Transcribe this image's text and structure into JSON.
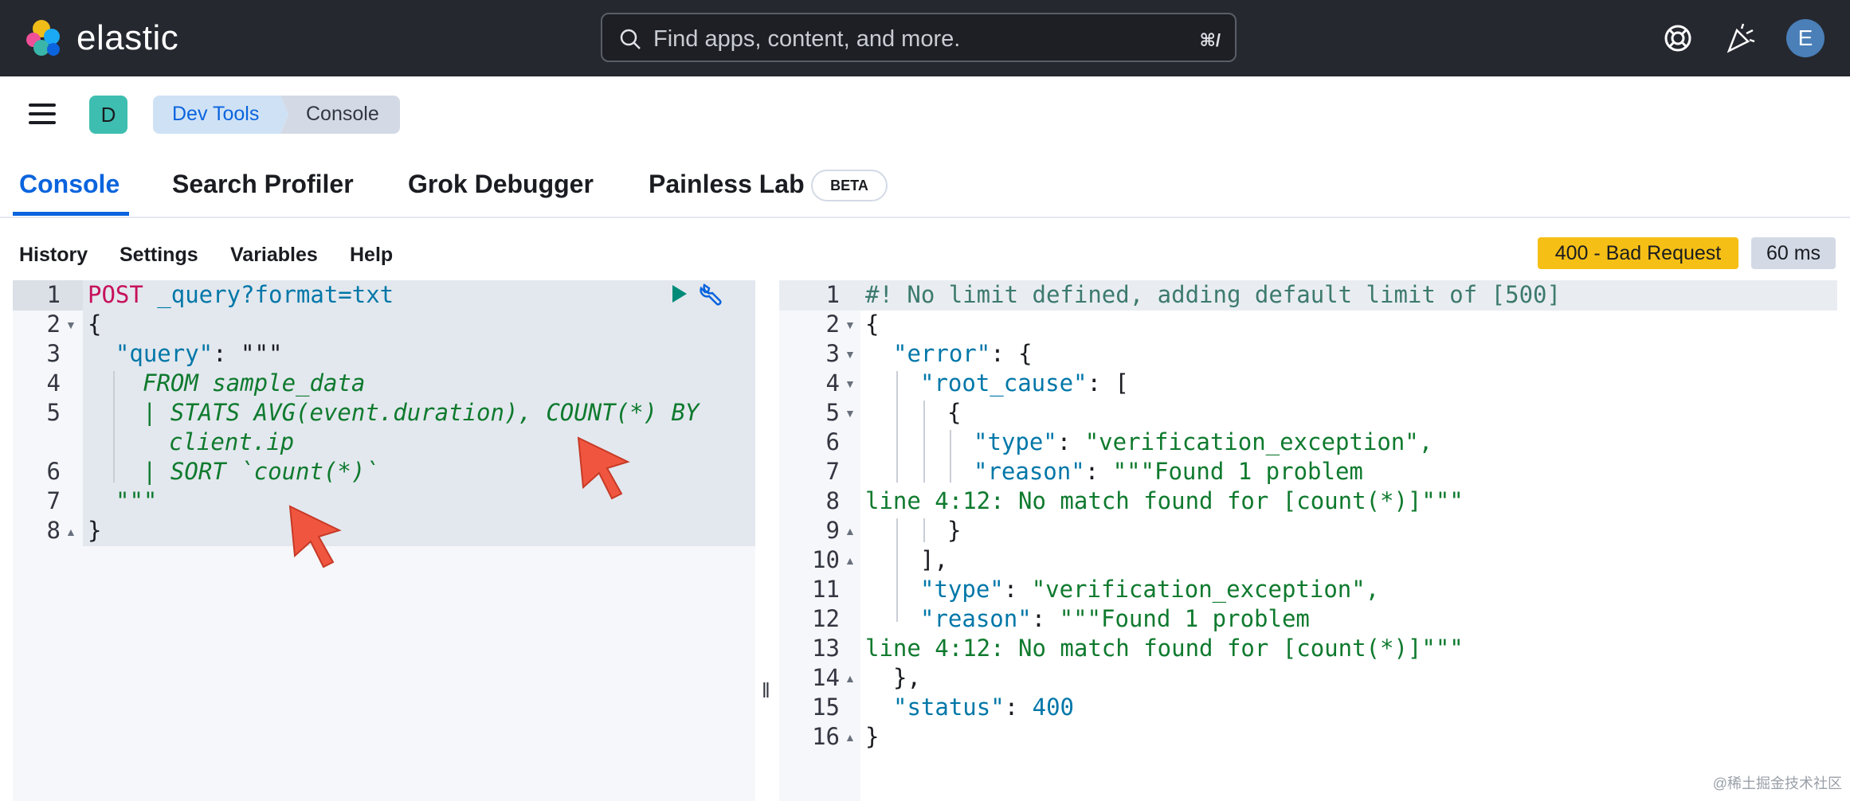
{
  "header": {
    "brand": "elastic",
    "search_placeholder": "Find apps, content, and more.",
    "search_shortcut": "⌘/",
    "avatar_initial": "E",
    "icons": [
      "help-lifebuoy-icon",
      "whats-new-party-icon"
    ]
  },
  "breadcrumbs": {
    "space_initial": "D",
    "items": [
      "Dev Tools",
      "Console"
    ]
  },
  "tabs": [
    {
      "label": "Console",
      "active": true
    },
    {
      "label": "Search Profiler"
    },
    {
      "label": "Grok Debugger"
    },
    {
      "label": "Painless Lab",
      "badge": "BETA"
    }
  ],
  "menu": [
    "History",
    "Settings",
    "Variables",
    "Help"
  ],
  "response": {
    "status": "400 - Bad Request",
    "time": "60 ms"
  },
  "request_editor": {
    "line_numbers": [
      "1",
      "2",
      "3",
      "4",
      "5",
      "6",
      "7",
      "8"
    ],
    "lines": [
      {
        "method": "POST",
        "path": " _query?format=txt"
      },
      "{",
      {
        "key": "\"query\"",
        "rest": ": \"\"\""
      },
      "FROM sample_data",
      "| STATS AVG(event.duration), COUNT(*) BY",
      "client.ip",
      "| SORT `count(*)`",
      "\"\"\"",
      "}"
    ]
  },
  "response_editor": {
    "line_numbers": [
      "1",
      "2",
      "3",
      "4",
      "5",
      "6",
      "7",
      "8",
      "9",
      "10",
      "11",
      "12",
      "13",
      "14",
      "15",
      "16"
    ],
    "lines": [
      "#! No limit defined, adding default limit of [500]",
      "{",
      {
        "key": "\"error\"",
        "rest": ": {"
      },
      {
        "key": "\"root_cause\"",
        "rest": ": ["
      },
      "{",
      {
        "key": "\"type\"",
        "rest": ": ",
        "value": "\"verification_exception\","
      },
      {
        "key": "\"reason\"",
        "rest": ": ",
        "value": "\"\"\"Found 1 problem"
      },
      "line 4:12: No match found for [count(*)]\"\"\"",
      "}",
      "],",
      {
        "key": "\"type\"",
        "rest": ": ",
        "value": "\"verification_exception\","
      },
      {
        "key": "\"reason\"",
        "rest": ": ",
        "value": "\"\"\"Found 1 problem"
      },
      "line 4:12: No match found for [count(*)]\"\"\"",
      "},",
      {
        "key": "\"status\"",
        "rest": ": ",
        "value": "400"
      },
      "}"
    ]
  },
  "watermark": "@稀土掘金技术社区",
  "colors": {
    "header_bg": "#25282f",
    "accent": "#0b64dd",
    "status_warning": "#f5bf15",
    "code_string": "#0f7a2e",
    "code_key": "#0077a8",
    "code_method": "#c6115b"
  }
}
